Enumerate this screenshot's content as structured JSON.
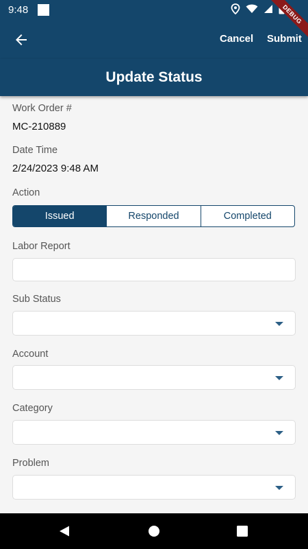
{
  "status_bar": {
    "time": "9:48"
  },
  "debug_banner": "DEBUG",
  "app_bar": {
    "cancel_label": "Cancel",
    "submit_label": "Submit"
  },
  "page": {
    "title": "Update Status"
  },
  "form": {
    "work_order_label": "Work Order #",
    "work_order_value": "MC-210889",
    "date_time_label": "Date Time",
    "date_time_value": "2/24/2023 9:48 AM",
    "action_label": "Action",
    "actions": [
      {
        "label": "Issued",
        "selected": true
      },
      {
        "label": "Responded",
        "selected": false
      },
      {
        "label": "Completed",
        "selected": false
      }
    ],
    "labor_report_label": "Labor Report",
    "labor_report_value": "",
    "sub_status_label": "Sub Status",
    "sub_status_value": "",
    "account_label": "Account",
    "account_value": "",
    "category_label": "Category",
    "category_value": "",
    "problem_label": "Problem",
    "problem_value": ""
  },
  "colors": {
    "primary": "#14466b",
    "background": "#f5f5f5"
  }
}
